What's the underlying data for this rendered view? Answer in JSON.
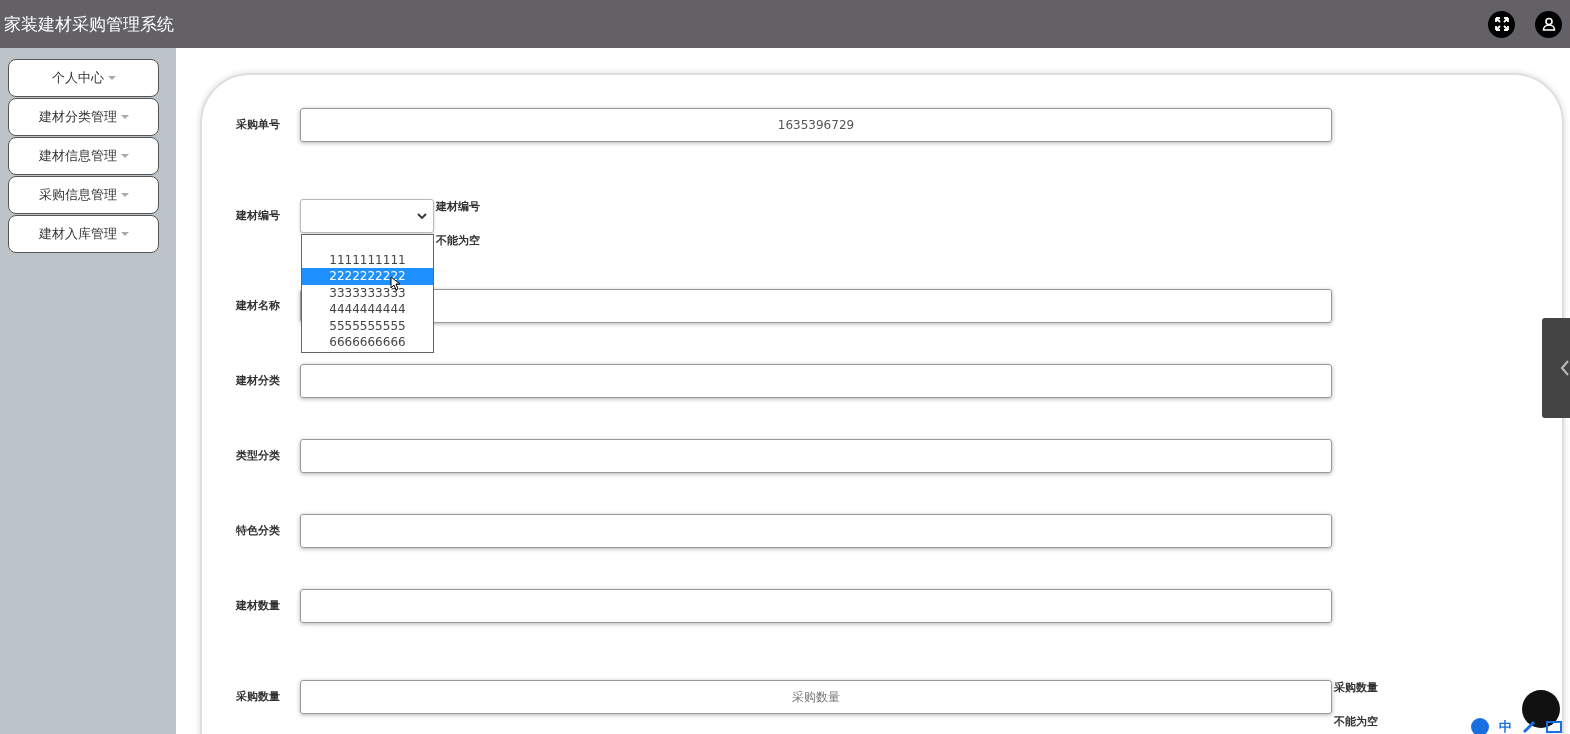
{
  "header": {
    "title": "家装建材采购管理系统"
  },
  "sidebar": {
    "items": [
      {
        "label": "个人中心"
      },
      {
        "label": "建材分类管理"
      },
      {
        "label": "建材信息管理"
      },
      {
        "label": "采购信息管理"
      },
      {
        "label": "建材入库管理"
      }
    ]
  },
  "form": {
    "fields": [
      {
        "kind": "text",
        "label": "采购单号",
        "value": "1635396729"
      },
      {
        "kind": "select",
        "label": "建材编号",
        "hints": [
          "建材编号",
          "不能为空"
        ],
        "options": [
          {
            "selected": false
          },
          {
            "label": "1111111111",
            "selected": false
          },
          {
            "label": "2222222222",
            "selected": true
          },
          {
            "label": "3333333333",
            "selected": false
          },
          {
            "label": "4444444444",
            "selected": false
          },
          {
            "label": "5555555555",
            "selected": false
          },
          {
            "label": "6666666666",
            "selected": false
          }
        ]
      },
      {
        "kind": "text",
        "label": "建材名称"
      },
      {
        "kind": "text",
        "label": "建材分类"
      },
      {
        "kind": "text",
        "label": "类型分类"
      },
      {
        "kind": "text",
        "label": "特色分类"
      },
      {
        "kind": "text",
        "label": "建材数量"
      },
      {
        "kind": "text",
        "label": "采购数量",
        "placeholder": "采购数量",
        "hints": [
          "采购数量",
          "不能为空"
        ]
      }
    ]
  },
  "ime_toolbar": {
    "mode": "中"
  }
}
